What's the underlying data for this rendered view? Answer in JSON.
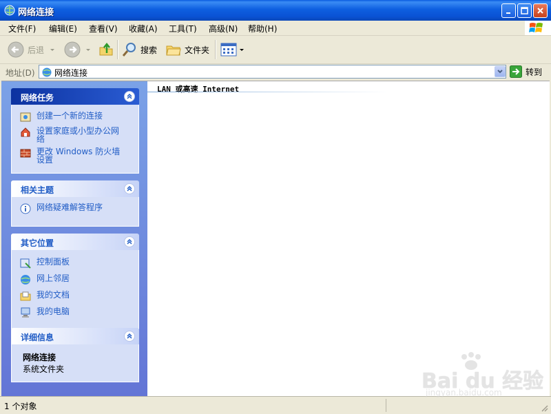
{
  "window": {
    "title": "网络连接"
  },
  "menu": [
    "文件(F)",
    "编辑(E)",
    "查看(V)",
    "收藏(A)",
    "工具(T)",
    "高级(N)",
    "帮助(H)"
  ],
  "toolbar": {
    "back_label": "后退",
    "search_label": "搜索",
    "folders_label": "文件夹"
  },
  "address": {
    "label": "地址(D)",
    "value": "网络连接",
    "go_label": "转到"
  },
  "panels": {
    "network_tasks": {
      "title": "网络任务",
      "items": [
        "创建一个新的连接",
        "设置家庭或小型办公网络",
        "更改 Windows 防火墙设置"
      ]
    },
    "related_topics": {
      "title": "相关主题",
      "items": [
        "网络疑难解答程序"
      ]
    },
    "other_places": {
      "title": "其它位置",
      "items": [
        "控制面板",
        "网上邻居",
        "我的文档",
        "我的电脑"
      ]
    },
    "details": {
      "title": "详细信息",
      "name": "网络连接",
      "type": "系统文件夹"
    }
  },
  "content": {
    "group_header": "LAN 或高速 Internet"
  },
  "status": {
    "text": "1 个对象"
  },
  "watermark": {
    "logo": "Bai du 经验",
    "url": "jingyan.baidu.com"
  },
  "colors": {
    "titlebar": "#0a52d4",
    "sidepane": "#6e8ddd",
    "link": "#215dc6",
    "panel_body": "#d6dff7"
  }
}
